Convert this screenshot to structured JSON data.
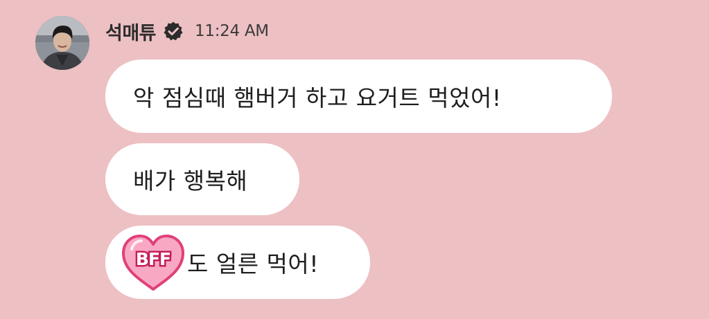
{
  "sender": {
    "name": "석매튜",
    "verified_icon": "verified-badge-icon",
    "time": "11:24 AM"
  },
  "avatar": {
    "icon": "profile-photo"
  },
  "messages": [
    {
      "text": "악 점심때 햄버거 하고 요거트 먹었어!"
    },
    {
      "text": "배가 행복해"
    },
    {
      "emoji_text": "BFF",
      "emoji_icon": "bff-heart-emoji-icon",
      "text": "도 얼른 먹어!"
    }
  ],
  "colors": {
    "background": "#EDC0C3",
    "bubble": "#FFFFFF",
    "heart_fill": "#F9A8C4",
    "heart_outline": "#E0407A"
  }
}
